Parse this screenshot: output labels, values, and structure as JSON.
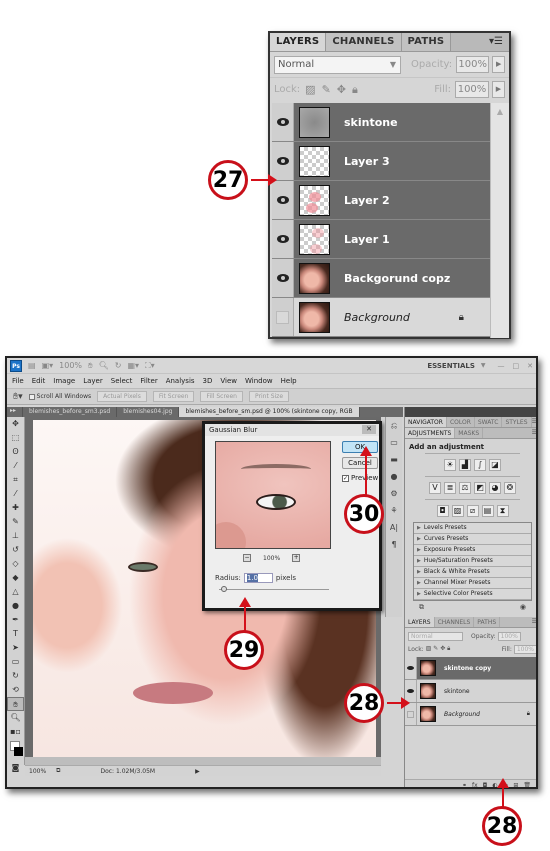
{
  "top_panel": {
    "tabs": [
      "LAYERS",
      "CHANNELS",
      "PATHS"
    ],
    "active_tab": "LAYERS",
    "menu_icon": "panel-menu-icon",
    "blend_mode": "Normal",
    "opacity_label": "Opacity:",
    "opacity_value": "100%",
    "lock_label": "Lock:",
    "fill_label": "Fill:",
    "fill_value": "100%",
    "layers": [
      {
        "name": "skintone",
        "visible": true,
        "thumb": "blurred-gray",
        "selected": true
      },
      {
        "name": "Layer 3",
        "visible": true,
        "thumb": "transparent",
        "selected": true
      },
      {
        "name": "Layer 2",
        "visible": true,
        "thumb": "transparent-pink",
        "selected": true
      },
      {
        "name": "Layer 1",
        "visible": true,
        "thumb": "transparent-pink",
        "selected": true
      },
      {
        "name": "Backgorund copz",
        "visible": true,
        "thumb": "face",
        "selected": true
      },
      {
        "name": "Background",
        "visible": false,
        "thumb": "face",
        "selected": false,
        "locked": true
      }
    ]
  },
  "callouts": {
    "c27": "27",
    "c30": "30",
    "c29": "29",
    "c28a": "28",
    "c28b": "28"
  },
  "ps_window": {
    "app_logo": "Ps",
    "zoom_dropdown": "100%",
    "workspace": "ESSENTIALS",
    "menu": [
      "File",
      "Edit",
      "Image",
      "Layer",
      "Select",
      "Filter",
      "Analysis",
      "3D",
      "View",
      "Window",
      "Help"
    ],
    "options": {
      "scroll_all": "Scroll All Windows",
      "buttons": [
        "Actual Pixels",
        "Fit Screen",
        "Fill Screen",
        "Print Size"
      ]
    },
    "doc_tabs": [
      {
        "label": "blemishes_before_sm3.psd",
        "active": false
      },
      {
        "label": "blemishes04.jpg",
        "active": false
      },
      {
        "label": "blemishes_before_sm.psd @ 100% (skintone copy, RGB",
        "active": true
      }
    ],
    "status": {
      "zoom": "100%",
      "doc": "Doc: 1.02M/3.05M"
    }
  },
  "gaussian_blur": {
    "title": "Gaussian Blur",
    "ok": "OK",
    "cancel": "Cancel",
    "preview_label": "Preview",
    "preview_checked": true,
    "zoom_value": "100%",
    "radius_label": "Radius:",
    "radius_value": "1.0",
    "radius_unit": "pixels"
  },
  "right_panel": {
    "top_tabs": [
      "NAVIGATOR",
      "COLOR",
      "SWATC",
      "STYLES"
    ],
    "adj_tabs": [
      "ADJUSTMENTS",
      "MASKS"
    ],
    "add_adjustment": "Add an adjustment",
    "presets": [
      "Levels Presets",
      "Curves Presets",
      "Exposure Presets",
      "Hue/Saturation Presets",
      "Black & White Presets",
      "Channel Mixer Presets",
      "Selective Color Presets"
    ],
    "layers_tabs": [
      "LAYERS",
      "CHANNELS",
      "PATHS"
    ],
    "blend_mode": "Normal",
    "opacity_label": "Opacity:",
    "opacity_value": "100%",
    "lock_label": "Lock:",
    "fill_label": "Fill:",
    "fill_value": "100%",
    "layers": [
      {
        "name": "skintone copy",
        "visible": true,
        "selected": true
      },
      {
        "name": "skintone",
        "visible": true,
        "selected": false
      },
      {
        "name": "Background",
        "visible": false,
        "selected": false,
        "locked": true
      }
    ]
  }
}
